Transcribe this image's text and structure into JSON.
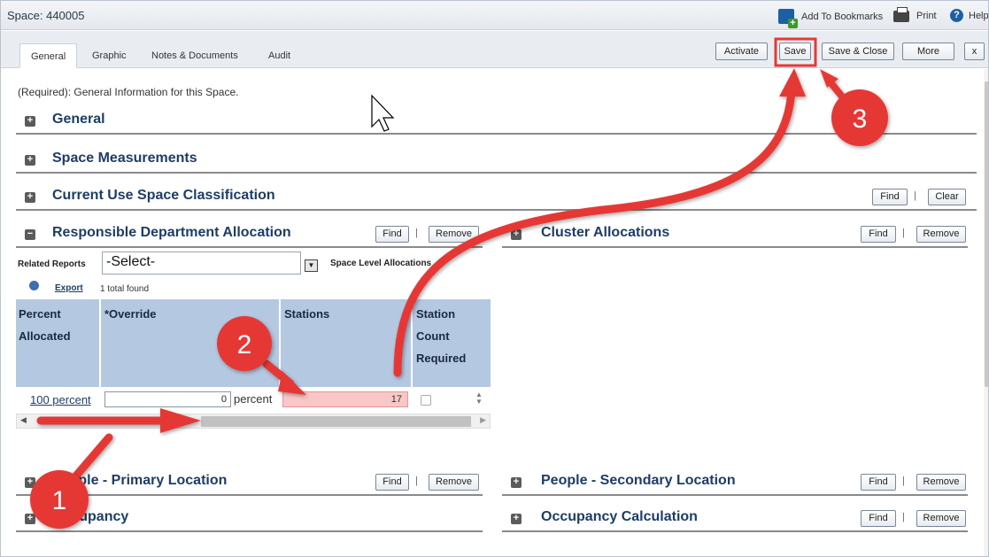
{
  "window": {
    "title": "Space: 440005"
  },
  "titlebar": {
    "bookmarks": "Add To Bookmarks",
    "print": "Print",
    "help": "Help"
  },
  "tabs": [
    {
      "label": "General"
    },
    {
      "label": "Graphic"
    },
    {
      "label": "Notes & Documents"
    },
    {
      "label": "Audit"
    }
  ],
  "header_buttons": {
    "activate": "Activate",
    "save": "Save",
    "save_close": "Save & Close",
    "more": "More",
    "close": "x"
  },
  "required_text": "(Required): General Information for this Space.",
  "sections": {
    "general": "General",
    "space_measurements": "Space Measurements",
    "current_use": "Current Use Space Classification",
    "dept_allocation": "Responsible Department Allocation",
    "cluster_allocations": "Cluster Allocations",
    "people_primary": "People - Primary Location",
    "people_secondary": "People - Secondary Location",
    "occupancy": "Occupancy",
    "occupancy_calc": "Occupancy Calculation"
  },
  "buttons": {
    "find": "Find",
    "clear": "Clear",
    "remove": "Remove",
    "separator": "|"
  },
  "toggles": {
    "collapsed": "+",
    "expanded": "−"
  },
  "dept": {
    "related_reports_label": "Related Reports",
    "select_value": "-Select-",
    "space_level_label": "Space Level Allocations",
    "export": "Export",
    "total_found": "1 total found",
    "columns": {
      "percent": [
        "Percent",
        "Allocated"
      ],
      "override": "*Override",
      "stations": "Stations",
      "station_count": [
        "Station",
        "Count",
        "Required"
      ]
    },
    "row": {
      "percent_link": "100 percent",
      "override_value": "0",
      "percent_label": "percent",
      "stations_value": "17",
      "station_count_required": false
    }
  },
  "annotations": {
    "step1": "1",
    "step2": "2",
    "step3": "3"
  },
  "colors": {
    "accent_red": "#e53935",
    "header_blue": "#b4c8e2",
    "section_title": "#1e3d66",
    "error_field": "#f9c7c7"
  }
}
